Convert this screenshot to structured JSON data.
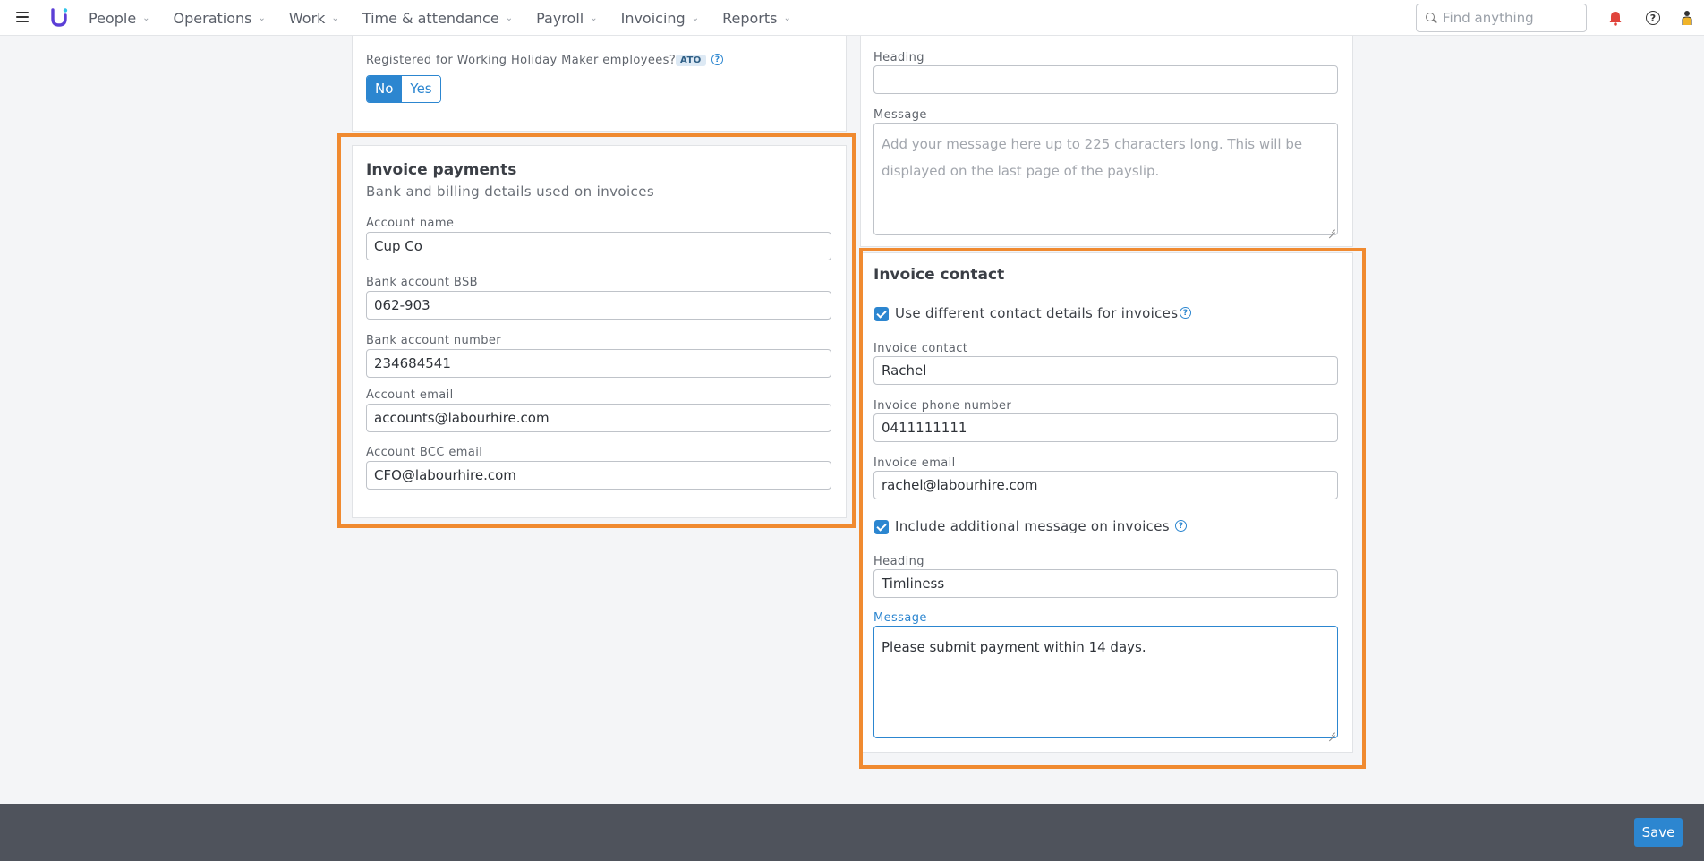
{
  "nav": {
    "items": [
      {
        "label": "People"
      },
      {
        "label": "Operations"
      },
      {
        "label": "Work"
      },
      {
        "label": "Time & attendance"
      },
      {
        "label": "Payroll"
      },
      {
        "label": "Invoicing"
      },
      {
        "label": "Reports"
      }
    ],
    "search_placeholder": "Find anything"
  },
  "whm": {
    "question": "Registered for Working Holiday Maker employees?",
    "badge": "ATO",
    "options": {
      "no": "No",
      "yes": "Yes"
    },
    "selected": "No"
  },
  "payslip_message": {
    "heading_label": "Heading",
    "heading_value": "",
    "message_label": "Message",
    "message_placeholder": "Add your message here up to 225 characters long. This will be displayed on the last page of the payslip."
  },
  "invoice_payments": {
    "title": "Invoice payments",
    "subtitle": "Bank and billing details used on invoices",
    "account_name_label": "Account name",
    "account_name": "Cup Co",
    "bsb_label": "Bank account BSB",
    "bsb": "062-903",
    "account_number_label": "Bank account number",
    "account_number": "234684541",
    "account_email_label": "Account email",
    "account_email": "accounts@labourhire.com",
    "bcc_email_label": "Account BCC email",
    "bcc_email": "CFO@labourhire.com"
  },
  "invoice_contact": {
    "title": "Invoice contact",
    "use_different_label": "Use different contact details for invoices",
    "use_different_checked": true,
    "contact_label": "Invoice contact",
    "contact": "Rachel",
    "phone_label": "Invoice phone number",
    "phone": "0411111111",
    "email_label": "Invoice email",
    "email": "rachel@labourhire.com",
    "include_message_label": "Include additional message on invoices",
    "include_message_checked": true,
    "heading_label": "Heading",
    "heading": "Timliness",
    "message_label": "Message",
    "message": "Please submit payment within 14 days."
  },
  "footer": {
    "save_label": "Save"
  },
  "colors": {
    "accent": "#2c86d0",
    "highlight": "#f08a30",
    "footer": "#4f535c",
    "bell": "#e0443c"
  }
}
